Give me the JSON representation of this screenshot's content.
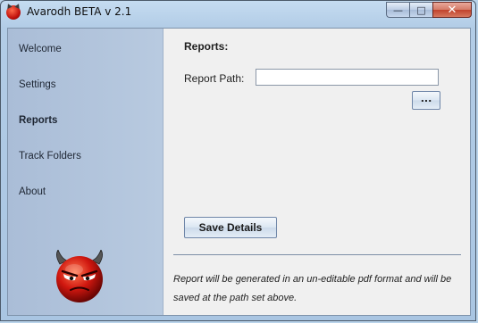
{
  "window": {
    "title": "Avarodh BETA v 2.1",
    "controls": {
      "minimize": "—",
      "maximize": "□",
      "close": "✕"
    }
  },
  "sidebar": {
    "items": [
      {
        "label": "Welcome",
        "active": false
      },
      {
        "label": "Settings",
        "active": false
      },
      {
        "label": "Reports",
        "active": true
      },
      {
        "label": "Track Folders",
        "active": false
      },
      {
        "label": "About",
        "active": false
      }
    ],
    "mascot_icon": "devil-face-icon"
  },
  "reports": {
    "heading": "Reports:",
    "path_label": "Report Path:",
    "path_value": "",
    "browse_label": "...",
    "save_label": "Save Details",
    "note": "Report will be generated in an un-editable pdf format and will be saved at the path set above."
  },
  "colors": {
    "sidebar": "#b0c4dc",
    "content": "#f0f0f0",
    "accent": "#c1120d"
  }
}
